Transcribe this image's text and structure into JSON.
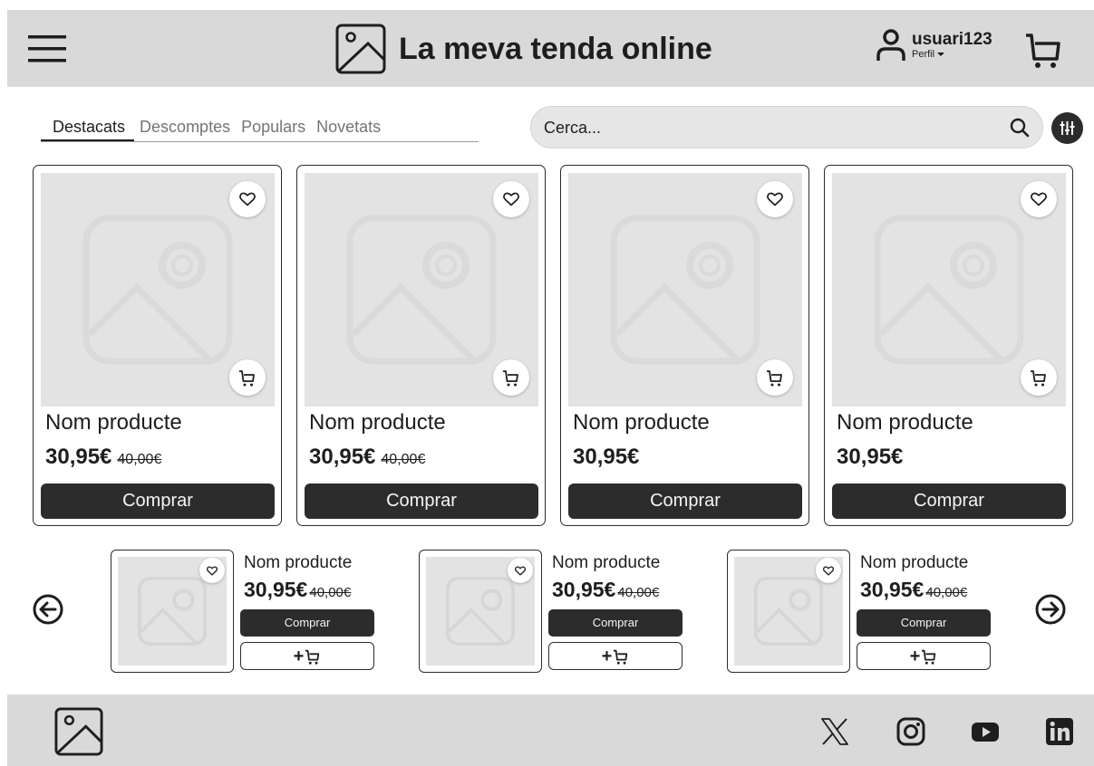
{
  "header": {
    "title": "La meva tenda online",
    "username": "usuari123",
    "profile_label": "Perfil"
  },
  "tabs": [
    {
      "label": "Destacats",
      "active": true
    },
    {
      "label": "Descomptes",
      "active": false
    },
    {
      "label": "Populars",
      "active": false
    },
    {
      "label": "Novetats",
      "active": false
    }
  ],
  "search": {
    "placeholder": "Cerca..."
  },
  "products": [
    {
      "name": "Nom producte",
      "price": "30,95€",
      "old_price": "40,00€",
      "buy_label": "Comprar"
    },
    {
      "name": "Nom producte",
      "price": "30,95€",
      "old_price": "40,00€",
      "buy_label": "Comprar"
    },
    {
      "name": "Nom producte",
      "price": "30,95€",
      "old_price": "",
      "buy_label": "Comprar"
    },
    {
      "name": "Nom producte",
      "price": "30,95€",
      "old_price": "",
      "buy_label": "Comprar"
    }
  ],
  "carousel": [
    {
      "name": "Nom producte",
      "price": "30,95€",
      "old_price": "40,00€",
      "buy_label": "Comprar",
      "add_label": "+"
    },
    {
      "name": "Nom producte",
      "price": "30,95€",
      "old_price": "40,00€",
      "buy_label": "Comprar",
      "add_label": "+"
    },
    {
      "name": "Nom producte",
      "price": "30,95€",
      "old_price": "40,00€",
      "buy_label": "Comprar",
      "add_label": "+"
    }
  ],
  "footer": {
    "social_icons": [
      "x-icon",
      "instagram-icon",
      "youtube-icon",
      "linkedin-icon"
    ]
  },
  "colors": {
    "header_bg": "#d9d9d9",
    "button_dark": "#2c2c2c",
    "placeholder_bg": "#e3e3e3",
    "text": "#1e1e1e"
  }
}
